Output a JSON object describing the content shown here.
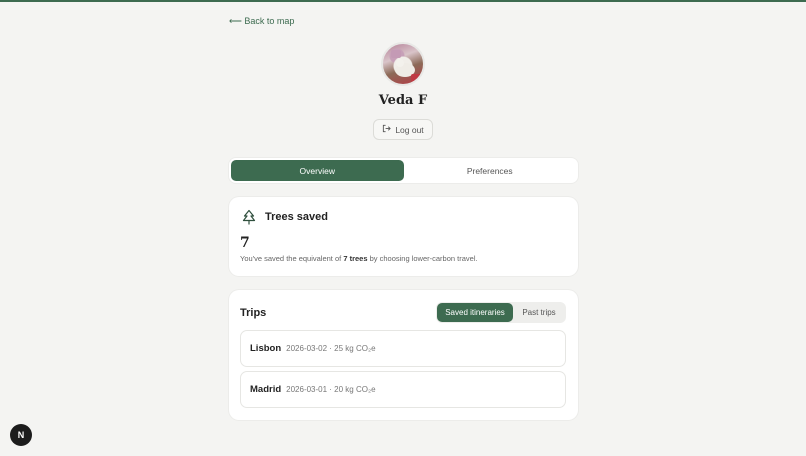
{
  "nav": {
    "back_label": "⟵ Back to map"
  },
  "profile": {
    "name": "Veda F",
    "logout_label": "Log out"
  },
  "tabs": [
    {
      "label": "Overview",
      "active": true
    },
    {
      "label": "Preferences",
      "active": false
    }
  ],
  "trees": {
    "title": "Trees saved",
    "count": "7",
    "desc_prefix": "You've saved the equivalent of ",
    "desc_bold": "7 trees",
    "desc_suffix": " by choosing lower-carbon travel."
  },
  "trips": {
    "title": "Trips",
    "segments": [
      {
        "label": "Saved itineraries",
        "active": true
      },
      {
        "label": "Past trips",
        "active": false
      }
    ],
    "items": [
      {
        "city": "Lisbon",
        "meta": "2026-03-02 · 25 kg CO₂e"
      },
      {
        "city": "Madrid",
        "meta": "2026-03-01 · 20 kg CO₂e"
      }
    ]
  },
  "badge": {
    "label": "N"
  },
  "colors": {
    "accent": "#3d6b50",
    "background": "#f4f4f2"
  }
}
